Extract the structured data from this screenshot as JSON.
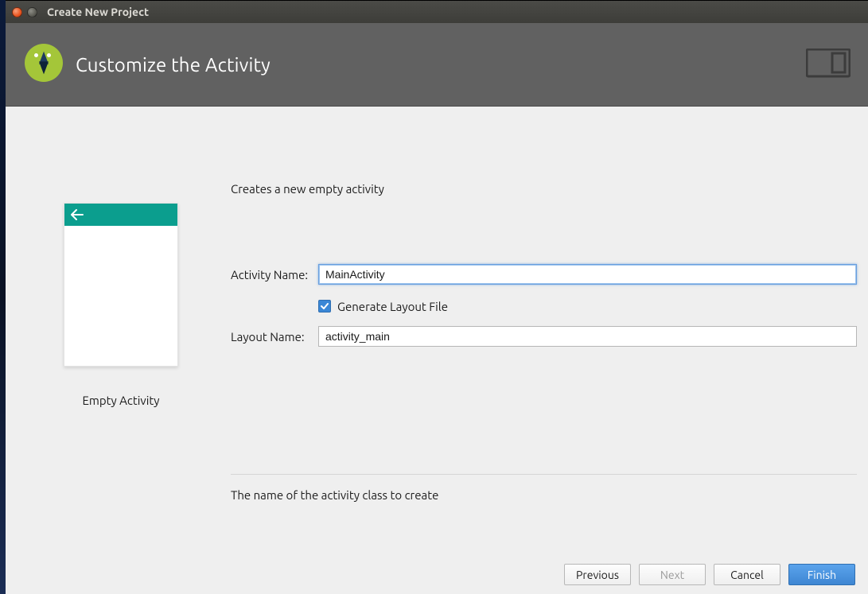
{
  "titlebar": {
    "title": "Create New Project"
  },
  "header": {
    "title": "Customize the Activity"
  },
  "preview": {
    "label": "Empty Activity"
  },
  "form": {
    "description": "Creates a new empty activity",
    "activity_name_label": "Activity Name:",
    "activity_name_value": "MainActivity",
    "generate_layout_label": "Generate Layout File",
    "generate_layout_checked": true,
    "layout_name_label": "Layout Name:",
    "layout_name_value": "activity_main",
    "hint": "The name of the activity class to create"
  },
  "buttons": {
    "previous": "Previous",
    "next": "Next",
    "cancel": "Cancel",
    "finish": "Finish"
  }
}
